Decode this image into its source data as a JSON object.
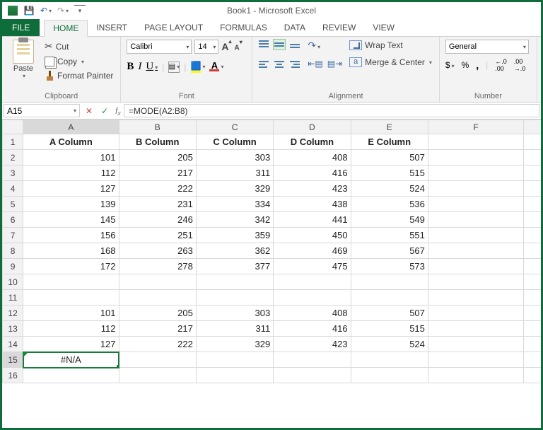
{
  "title": "Book1 - Microsoft Excel",
  "tabs": {
    "file": "FILE",
    "home": "HOME",
    "insert": "INSERT",
    "page": "PAGE LAYOUT",
    "formulas": "FORMULAS",
    "data": "DATA",
    "review": "REVIEW",
    "view": "VIEW"
  },
  "clipboard": {
    "cut": "Cut",
    "copy": "Copy",
    "fp": "Format Painter",
    "paste": "Paste",
    "group": "Clipboard"
  },
  "font": {
    "group": "Font",
    "name": "Calibri",
    "size": "14",
    "b": "B",
    "i": "I",
    "u": "U",
    "A": "A"
  },
  "alignment": {
    "group": "Alignment",
    "wrap": "Wrap Text",
    "merge": "Merge & Center"
  },
  "number": {
    "group": "Number",
    "fmt": "General",
    "dollar": "$",
    "pct": "%",
    "comma": ",",
    "dec_inc": ".0 .00",
    "dec_dec": ".00 .0"
  },
  "cellref": "A15",
  "formula": "=MODE(A2:B8)",
  "colHeaders": [
    "A",
    "B",
    "C",
    "D",
    "E",
    "F"
  ],
  "headers": {
    "A": "A Column",
    "B": "B Column",
    "C": "C Column",
    "D": "D Column",
    "E": "E Column"
  },
  "rows": [
    {
      "n": 2,
      "A": 101,
      "B": 205,
      "C": 303,
      "D": 408,
      "E": 507
    },
    {
      "n": 3,
      "A": 112,
      "B": 217,
      "C": 311,
      "D": 416,
      "E": 515
    },
    {
      "n": 4,
      "A": 127,
      "B": 222,
      "C": 329,
      "D": 423,
      "E": 524
    },
    {
      "n": 5,
      "A": 139,
      "B": 231,
      "C": 334,
      "D": 438,
      "E": 536
    },
    {
      "n": 6,
      "A": 145,
      "B": 246,
      "C": 342,
      "D": 441,
      "E": 549
    },
    {
      "n": 7,
      "A": 156,
      "B": 251,
      "C": 359,
      "D": 450,
      "E": 551
    },
    {
      "n": 8,
      "A": 168,
      "B": 263,
      "C": 362,
      "D": 469,
      "E": 567
    },
    {
      "n": 9,
      "A": 172,
      "B": 278,
      "C": 377,
      "D": 475,
      "E": 573
    }
  ],
  "rows2": [
    {
      "n": 12,
      "A": 101,
      "B": 205,
      "C": 303,
      "D": 408,
      "E": 507
    },
    {
      "n": 13,
      "A": 112,
      "B": 217,
      "C": 311,
      "D": 416,
      "E": 515
    },
    {
      "n": 14,
      "A": 127,
      "B": 222,
      "C": 329,
      "D": 423,
      "E": 524
    }
  ],
  "err": "#N/A"
}
